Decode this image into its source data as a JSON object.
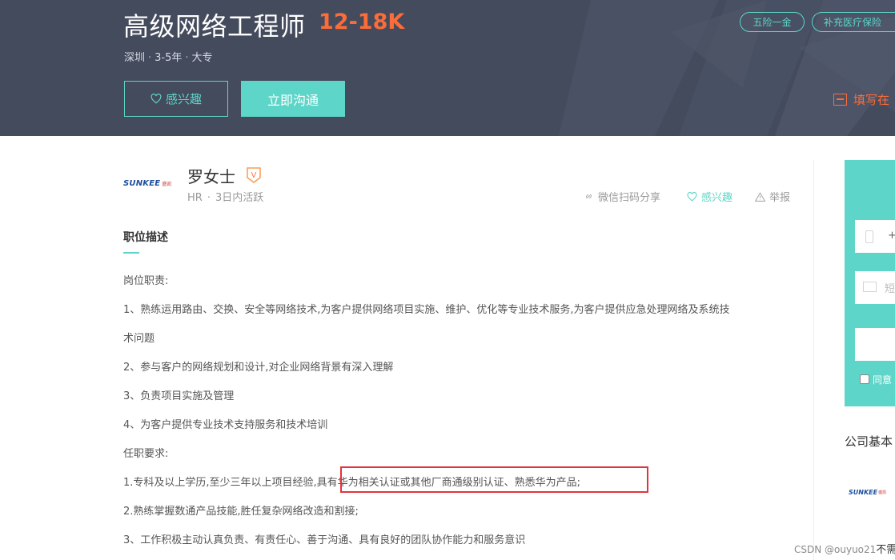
{
  "header": {
    "job_title": "高级网络工程师",
    "salary": "12-18K",
    "meta": {
      "city": "深圳",
      "experience": "3-5年",
      "education": "大专",
      "separator": "·"
    },
    "interest_button": "感兴趣",
    "chat_button": "立即沟通",
    "tags": [
      "五险一金",
      "补充医疗保险"
    ],
    "fill_resume": "填写在"
  },
  "hr": {
    "company_logo_text": "SUNKEE",
    "company_logo_cn": "盛凯",
    "name": "罗女士",
    "verified_badge": "V",
    "role": "HR",
    "separator": "·",
    "active": "3日内活跃",
    "actions": {
      "share": "微信扫码分享",
      "interest": "感兴趣",
      "report": "举报"
    }
  },
  "description": {
    "section_title": "职位描述",
    "lines": [
      "岗位职责:",
      "1、熟练运用路由、交换、安全等网络技术,为客户提供网络项目实施、维护、优化等专业技术服务,为客户提供应急处理网络及系统技",
      "术问题",
      "2、参与客户的网络规划和设计,对企业网络背景有深入理解",
      "3、负责项目实施及管理",
      "4、为客户提供专业技术支持服务和技术培训",
      "任职要求:",
      "1.专科及以上学历,至少三年以上项目经验,具有华为相关认证或其他厂商通级别认证、熟悉华为产品;",
      "2.熟练掌握数通产品技能,胜任复杂网络改造和割接;",
      "3、工作积极主动认真负责、有责任心、善于沟通、具有良好的团队协作能力和服务意识"
    ]
  },
  "sidebar": {
    "phone_prefix": "+",
    "sms_placeholder": "短",
    "agree_text": "同意",
    "company_basic_title": "公司基本",
    "company_logo_text": "SUNKEE",
    "company_logo_cn": "盛凯"
  },
  "watermark": {
    "text": "CSDN @ouyuo21",
    "tail": "不需"
  },
  "colors": {
    "accent": "#5dd5c8",
    "salary": "#fc6c38",
    "banner": "#444b5d",
    "highlight_box": "#e0353b"
  }
}
